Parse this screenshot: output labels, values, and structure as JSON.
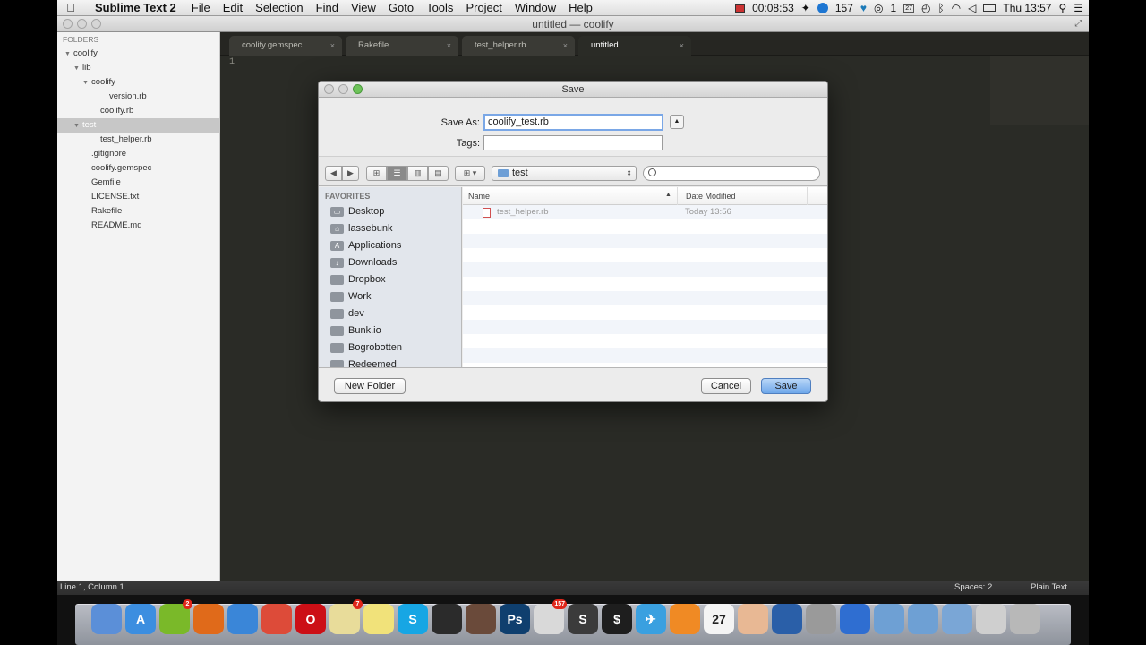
{
  "menubar": {
    "app_name": "Sublime Text 2",
    "items": [
      "File",
      "Edit",
      "Selection",
      "Find",
      "View",
      "Goto",
      "Tools",
      "Project",
      "Window",
      "Help"
    ],
    "recording_time": "00:08:53",
    "notification_count": "157",
    "calendar_day": "27",
    "spotlight_badge": "1",
    "clock": "Thu 13:57"
  },
  "window": {
    "title": "untitled — coolify"
  },
  "sidebar": {
    "header": "FOLDERS",
    "items": [
      {
        "label": "coolify",
        "indent": 1,
        "arrow": "▼"
      },
      {
        "label": "lib",
        "indent": 2,
        "arrow": "▼"
      },
      {
        "label": "coolify",
        "indent": 3,
        "arrow": "▼"
      },
      {
        "label": "version.rb",
        "indent": 5,
        "arrow": ""
      },
      {
        "label": "coolify.rb",
        "indent": 4,
        "arrow": ""
      },
      {
        "label": "test",
        "indent": 2,
        "arrow": "▼",
        "selected": true
      },
      {
        "label": "test_helper.rb",
        "indent": 4,
        "arrow": ""
      },
      {
        "label": ".gitignore",
        "indent": 3,
        "arrow": ""
      },
      {
        "label": "coolify.gemspec",
        "indent": 3,
        "arrow": ""
      },
      {
        "label": "Gemfile",
        "indent": 3,
        "arrow": ""
      },
      {
        "label": "LICENSE.txt",
        "indent": 3,
        "arrow": ""
      },
      {
        "label": "Rakefile",
        "indent": 3,
        "arrow": ""
      },
      {
        "label": "README.md",
        "indent": 3,
        "arrow": ""
      }
    ]
  },
  "tabs": [
    {
      "label": "coolify.gemspec",
      "active": false
    },
    {
      "label": "Rakefile",
      "active": false
    },
    {
      "label": "test_helper.rb",
      "active": false
    },
    {
      "label": "untitled",
      "active": true
    }
  ],
  "tab_close_glyph": "×",
  "editor": {
    "line_number": "1"
  },
  "statusbar": {
    "position": "Line 1, Column 1",
    "spaces": "Spaces: 2",
    "syntax": "Plain Text"
  },
  "dialog": {
    "title": "Save",
    "save_as_label": "Save As:",
    "save_as_value": "coolify_test.rb",
    "tags_label": "Tags:",
    "tags_value": "",
    "location": "test",
    "search_value": "",
    "favorites_header": "FAVORITES",
    "favorites": [
      {
        "label": "Desktop",
        "icon": "desktop-icon"
      },
      {
        "label": "lassebunk",
        "icon": "home-icon"
      },
      {
        "label": "Applications",
        "icon": "applications-icon"
      },
      {
        "label": "Downloads",
        "icon": "downloads-icon"
      },
      {
        "label": "Dropbox",
        "icon": "folder-icon"
      },
      {
        "label": "Work",
        "icon": "folder-icon"
      },
      {
        "label": "dev",
        "icon": "folder-icon"
      },
      {
        "label": "Bunk.io",
        "icon": "folder-icon"
      },
      {
        "label": "Bogrobotten",
        "icon": "folder-icon"
      },
      {
        "label": "Redeemed",
        "icon": "folder-icon"
      }
    ],
    "columns": {
      "name": "Name",
      "date": "Date Modified"
    },
    "files": [
      {
        "name": "test_helper.rb",
        "date": "Today 13:56"
      }
    ],
    "new_folder_label": "New Folder",
    "cancel_label": "Cancel",
    "save_label": "Save"
  },
  "dock": {
    "badges": {
      "spotify": "2",
      "stickies": "7",
      "sparrow": "157"
    },
    "calendar_day": "27",
    "apps": [
      "finder",
      "app-store",
      "spotify",
      "firefox",
      "safari",
      "chrome",
      "opera",
      "stickies",
      "notes",
      "skype",
      "activity-monitor",
      "mask",
      "photoshop",
      "sparrow",
      "sublime-text",
      "terminal",
      "twitter",
      "charts",
      "calendar",
      "nerd",
      "virtualbox",
      "calculator",
      "itunes",
      "folder-stack",
      "folder-stack",
      "applications-stack",
      "printer",
      "trash"
    ]
  },
  "colors": {
    "editor_bg": "#2a2b26",
    "sidebar_bg": "#f3f3f3",
    "save_button": "#6ea7ea",
    "selected_row": "#c7c7c7"
  }
}
